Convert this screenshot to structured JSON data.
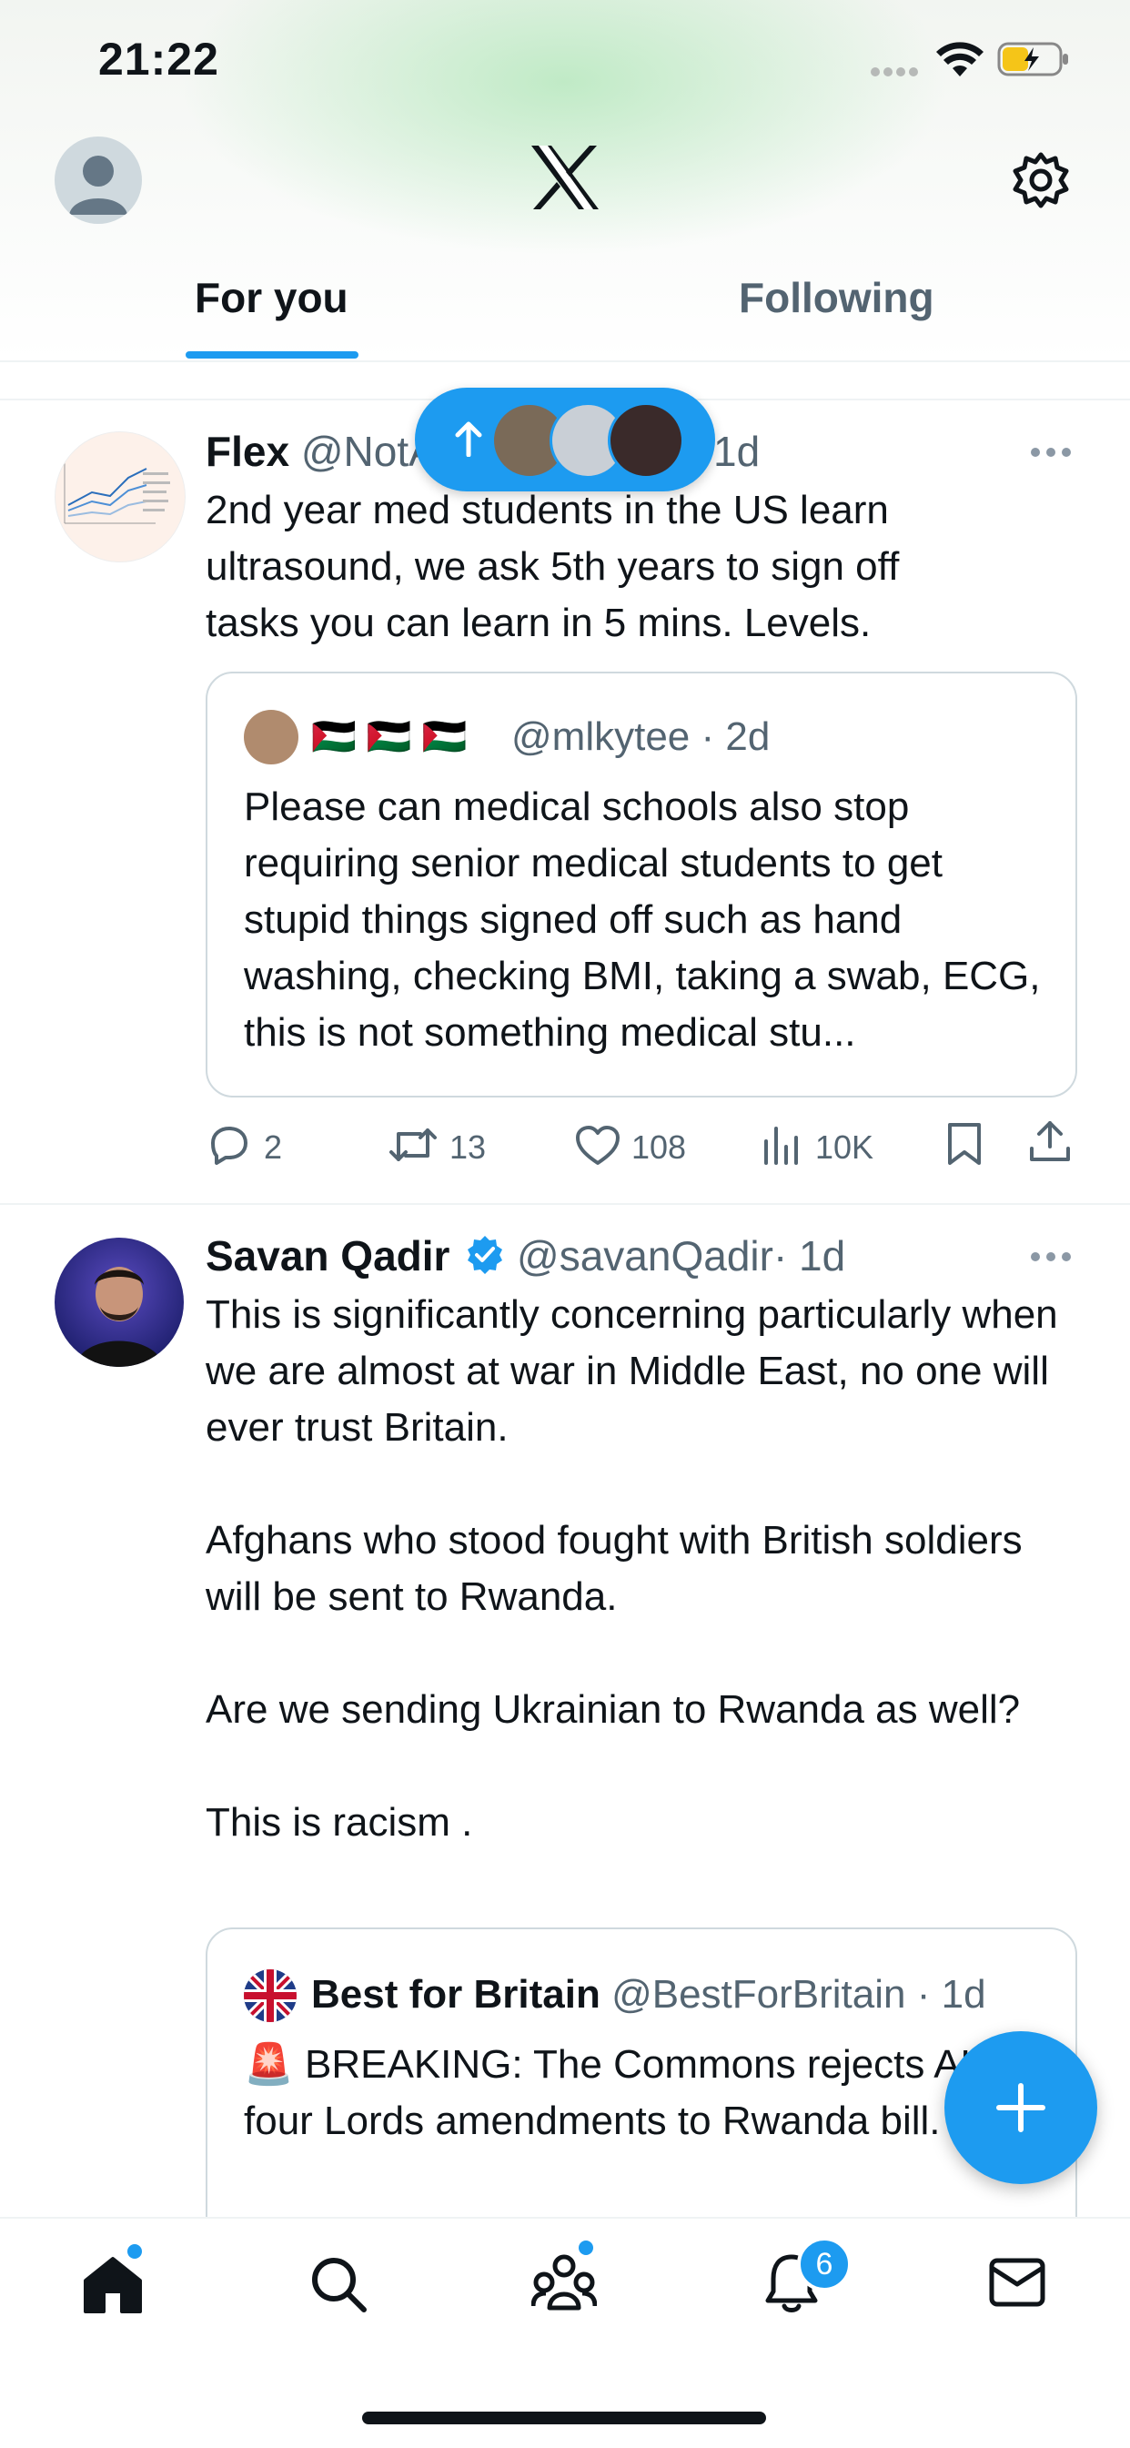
{
  "status_bar": {
    "time": "21:22"
  },
  "header": {
    "tab_for_you": "For you",
    "tab_following": "Following"
  },
  "new_posts_pill": {
    "icon": "arrow-up-icon"
  },
  "tweets": [
    {
      "name": "Flex",
      "handle": "@NotA",
      "time": "1d",
      "text": "2nd year med students in the US learn ultrasound, we ask 5th years to sign off tasks you can learn in 5 mins. Levels.",
      "quote": {
        "flags": "🇵🇸 🇵🇸 🇵🇸",
        "handle": "@mlkytee",
        "time": "· 2d",
        "text": "Please can medical schools also stop requiring senior medical students to get stupid things signed off such as hand washing, checking BMI, taking a swab, ECG, this is not something medical stu..."
      },
      "actions": {
        "replies": "2",
        "retweets": "13",
        "likes": "108",
        "views": "10K"
      }
    },
    {
      "name": "Savan Qadir",
      "handle": "@savanQadir",
      "time": "· 1d",
      "text": "This is significantly concerning particularly when we are almost at war in Middle East, no one will ever trust Britain.\n\nAfghans who stood fought with British soldiers will be sent to Rwanda.\n\nAre we sending Ukrainian to Rwanda as well?\n\nThis is racism .",
      "quote": {
        "name": "Best for Britain",
        "handle": "@BestForBritain",
        "time": "· 1d",
        "text": "🚨 BREAKING: The Commons rejects ALL four Lords amendments to Rwanda bill."
      }
    }
  ],
  "nav": {
    "notifications_badge": "6"
  },
  "colors": {
    "accent": "#1d9bf0",
    "text": "#0f1419",
    "muted": "#536471"
  }
}
